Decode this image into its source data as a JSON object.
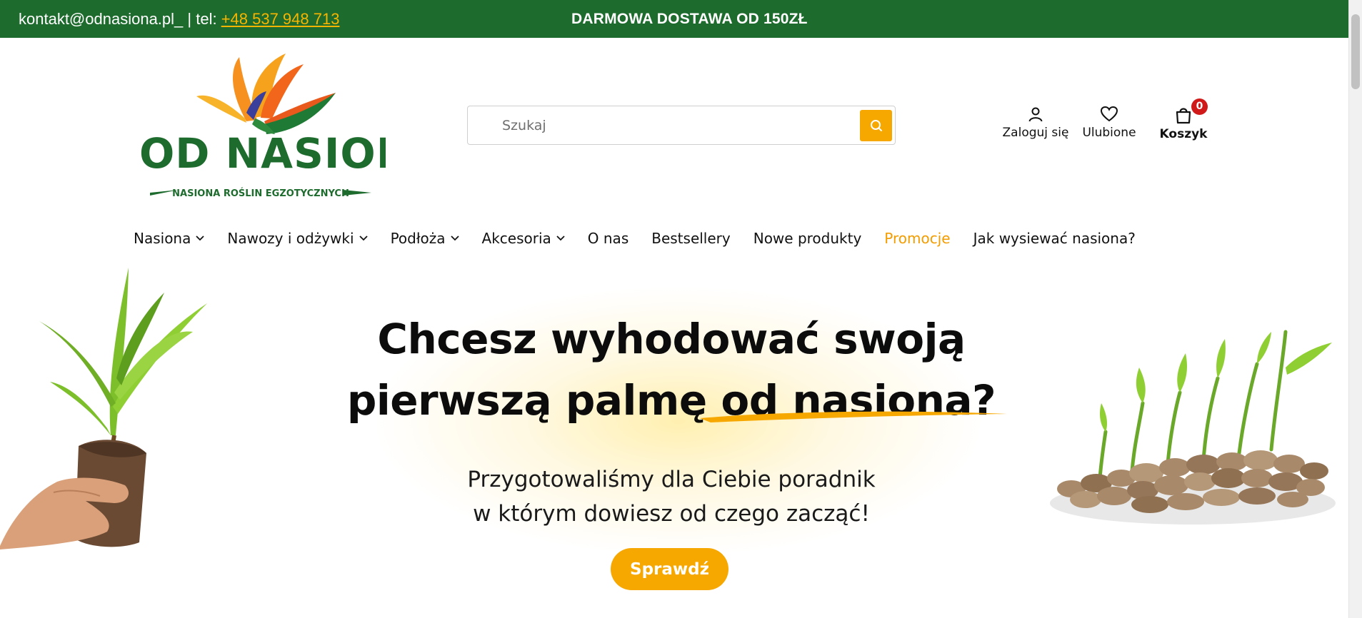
{
  "topbar": {
    "email": "kontakt@odnasiona.pl_",
    "tel_prefix": " | tel: ",
    "phone": "+48 537 948 713",
    "free_shipping": "DARMOWA DOSTAWA OD 150ZŁ"
  },
  "logo": {
    "name": "OD NASIONA",
    "tagline": "NASIONA ROŚLIN EGZOTYCZNYCH"
  },
  "search": {
    "placeholder": "Szukaj"
  },
  "header": {
    "login_label": "Zaloguj się",
    "favorites_label": "Ulubione",
    "cart_label": "Koszyk",
    "cart_count": "0"
  },
  "nav": {
    "items": [
      {
        "label": "Nasiona"
      },
      {
        "label": "Nawozy i odżywki"
      },
      {
        "label": "Podłoża"
      },
      {
        "label": "Akcesoria"
      },
      {
        "label": "O nas"
      },
      {
        "label": "Bestsellery"
      },
      {
        "label": "Nowe produkty"
      },
      {
        "label": "Promocje"
      },
      {
        "label": "Jak wysiewać nasiona?"
      }
    ]
  },
  "hero": {
    "title_line1": "Chcesz wyhodować swoją",
    "title_line2": "pierwszą palmę od nasiona?",
    "subtitle_line1": "Przygotowaliśmy dla Ciebie poradnik",
    "subtitle_line2": "w którym dowiesz od czego zacząć!",
    "cta_label": "Sprawdź"
  },
  "colors": {
    "topbar_bg": "#1e6b2e",
    "accent": "#f7a800",
    "promo_link": "#f39c00",
    "badge": "#d01919"
  },
  "icons": {
    "search": "search-icon",
    "user": "user-icon",
    "heart": "heart-icon",
    "bag": "shopping-bag-icon",
    "chevron": "chevron-down-icon"
  }
}
